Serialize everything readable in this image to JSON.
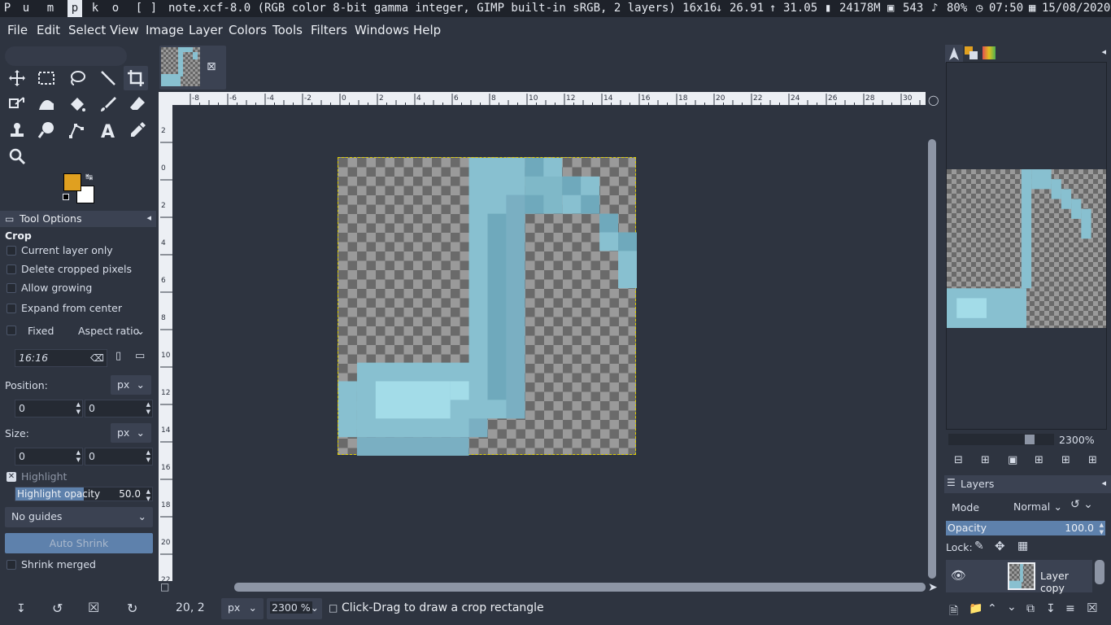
{
  "topbar": {
    "workspaces": [
      "P",
      "u",
      "m",
      "p",
      "k",
      "o",
      "[",
      "]"
    ],
    "active_workspace": 3,
    "window_title": "note.xcf-8.0 (RGB color 8-bit gamma integer, GIMP built-in sRGB, 2 layers) 16x16",
    "down_speed": "26.91",
    "up_speed": "31.05",
    "disk": "24178M",
    "memory": "543",
    "volume": "80%",
    "time": "07:50",
    "date": "15/08/2020"
  },
  "menubar": {
    "items": [
      "File",
      "Edit",
      "Select",
      "View",
      "Image",
      "Layer",
      "Colors",
      "Tools",
      "Filters",
      "Windows",
      "Help"
    ]
  },
  "toolbox": {
    "tools": [
      "move-tool",
      "rect-select-tool",
      "free-select-tool",
      "fuzzy-select-tool",
      "crop-tool",
      "transform-tool",
      "warp-tool",
      "bucket-fill-tool",
      "paintbrush-tool",
      "eraser-tool",
      "clone-tool",
      "smudge-tool",
      "paths-tool",
      "text-tool",
      "color-picker-tool",
      "zoom-tool"
    ],
    "active_tool": "crop-tool",
    "fg_color": "#e0a020",
    "bg_color": "#ffffff"
  },
  "tool_options": {
    "header": "Tool Options",
    "title": "Crop",
    "current_layer_only": "Current layer only",
    "delete_cropped": "Delete cropped pixels",
    "allow_growing": "Allow growing",
    "expand_center": "Expand from center",
    "fixed": "Fixed",
    "aspect_ratio": "Aspect ratio",
    "ratio_value": "16:16",
    "position_label": "Position:",
    "position_unit": "px",
    "position_x": "0",
    "position_y": "0",
    "size_label": "Size:",
    "size_unit": "px",
    "size_w": "0",
    "size_h": "0",
    "highlight": "Highlight",
    "highlight_opacity_label": "Highlight opacity",
    "highlight_opacity_value": "50.0",
    "highlight_opacity_fraction": 0.5,
    "guides": "No guides",
    "auto_shrink": "Auto Shrink",
    "shrink_merged": "Shrink merged"
  },
  "canvas": {
    "ruler_top_ticks": [
      "-8",
      "-6",
      "-4",
      "-2",
      "0",
      "2",
      "4",
      "6",
      "8",
      "10",
      "12",
      "14",
      "16",
      "18",
      "20",
      "22",
      "24",
      "26",
      "28",
      "30"
    ],
    "ruler_left_ticks": [
      "2",
      "0",
      "2",
      "4",
      "6",
      "8",
      "10",
      "12",
      "14",
      "16",
      "18",
      "20",
      "22"
    ],
    "accent_color": "#88c0d0"
  },
  "statusbar": {
    "coords": "20, 2",
    "unit": "px",
    "zoom": "2300 %",
    "message": "Click-Drag to draw a crop rectangle"
  },
  "navigator": {
    "zoom": "2300%"
  },
  "layers": {
    "header": "Layers",
    "mode_label": "Mode",
    "mode_value": "Normal",
    "opacity_label": "Opacity",
    "opacity_value": "100.0",
    "lock_label": "Lock:",
    "layer_name": "Layer copy"
  }
}
